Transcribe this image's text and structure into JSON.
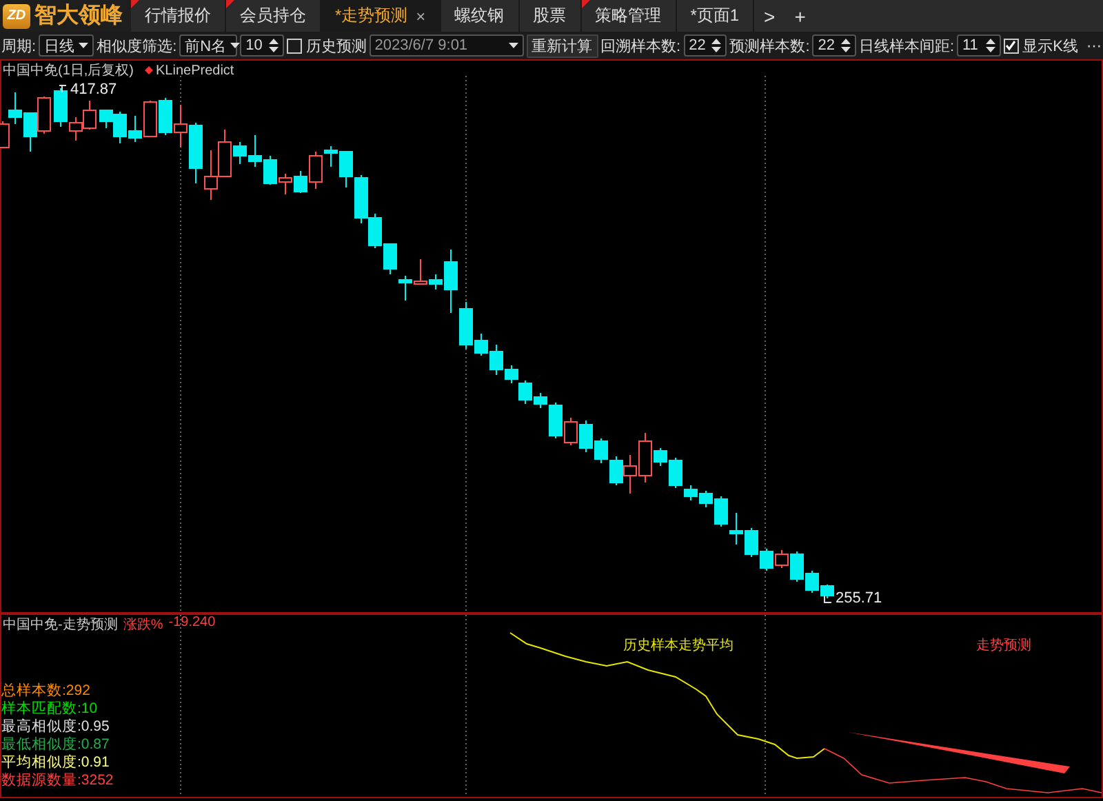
{
  "app": {
    "logo_mark": "ZD",
    "name": "智大领峰"
  },
  "tabs": [
    {
      "label": "行情报价",
      "selected": false,
      "marked": true
    },
    {
      "label": "会员持仓",
      "selected": false,
      "marked": true
    },
    {
      "label": "*走势预测",
      "selected": true,
      "marked": false,
      "close": "×"
    },
    {
      "label": "螺纹钢",
      "selected": false,
      "marked": false
    },
    {
      "label": "股票",
      "selected": false,
      "marked": false
    },
    {
      "label": "策略管理",
      "selected": false,
      "marked": true
    },
    {
      "label": "*页面1",
      "selected": false,
      "marked": false
    }
  ],
  "tab_actions": [
    ">",
    "+"
  ],
  "toolbar": [
    {
      "kind": "label",
      "text": "周期:"
    },
    {
      "kind": "select",
      "value": "日线"
    },
    {
      "kind": "label",
      "text": "相似度筛选:"
    },
    {
      "kind": "select",
      "value": "前N名"
    },
    {
      "kind": "spin",
      "value": "10"
    },
    {
      "kind": "checkbox",
      "label": "历史预测",
      "checked": false
    },
    {
      "kind": "date",
      "value": "2023/6/7 9:01",
      "disabled": true
    },
    {
      "kind": "button",
      "text": "重新计算"
    },
    {
      "kind": "label",
      "text": "回溯样本数:"
    },
    {
      "kind": "spin",
      "value": "22"
    },
    {
      "kind": "label",
      "text": "预测样本数:"
    },
    {
      "kind": "spin",
      "value": "22"
    },
    {
      "kind": "label",
      "text": "日线样本间距:"
    },
    {
      "kind": "spin",
      "value": "11"
    },
    {
      "kind": "checkbox",
      "label": "显示K线",
      "checked": true
    },
    {
      "kind": "more",
      "text": "⋯"
    }
  ],
  "main_chart": {
    "title": "中国中免(1日,后复权)",
    "indicator": "KLinePredict",
    "high_label": "417.87",
    "low_label": "255.71"
  },
  "predict_panel": {
    "title": "中国中免-走势预测",
    "change_label": "涨跌%",
    "change_value": "-19.240",
    "legend": [
      {
        "text": "历史样本走势平均",
        "color": "#e6e600"
      },
      {
        "text": "走势预测",
        "color": "#ff4040"
      }
    ],
    "stats": [
      {
        "text": "总样本数:292",
        "color": "#ff8c00"
      },
      {
        "text": "样本匹配数:10",
        "color": "#00e000"
      },
      {
        "text": "最高相似度:0.95",
        "color": "#e0e0e0"
      },
      {
        "text": "最低相似度:0.87",
        "color": "#22b14c"
      },
      {
        "text": "平均相似度:0.91",
        "color": "#ffff80"
      },
      {
        "text": "数据源数量:3252",
        "color": "#ff4040"
      }
    ]
  }
}
